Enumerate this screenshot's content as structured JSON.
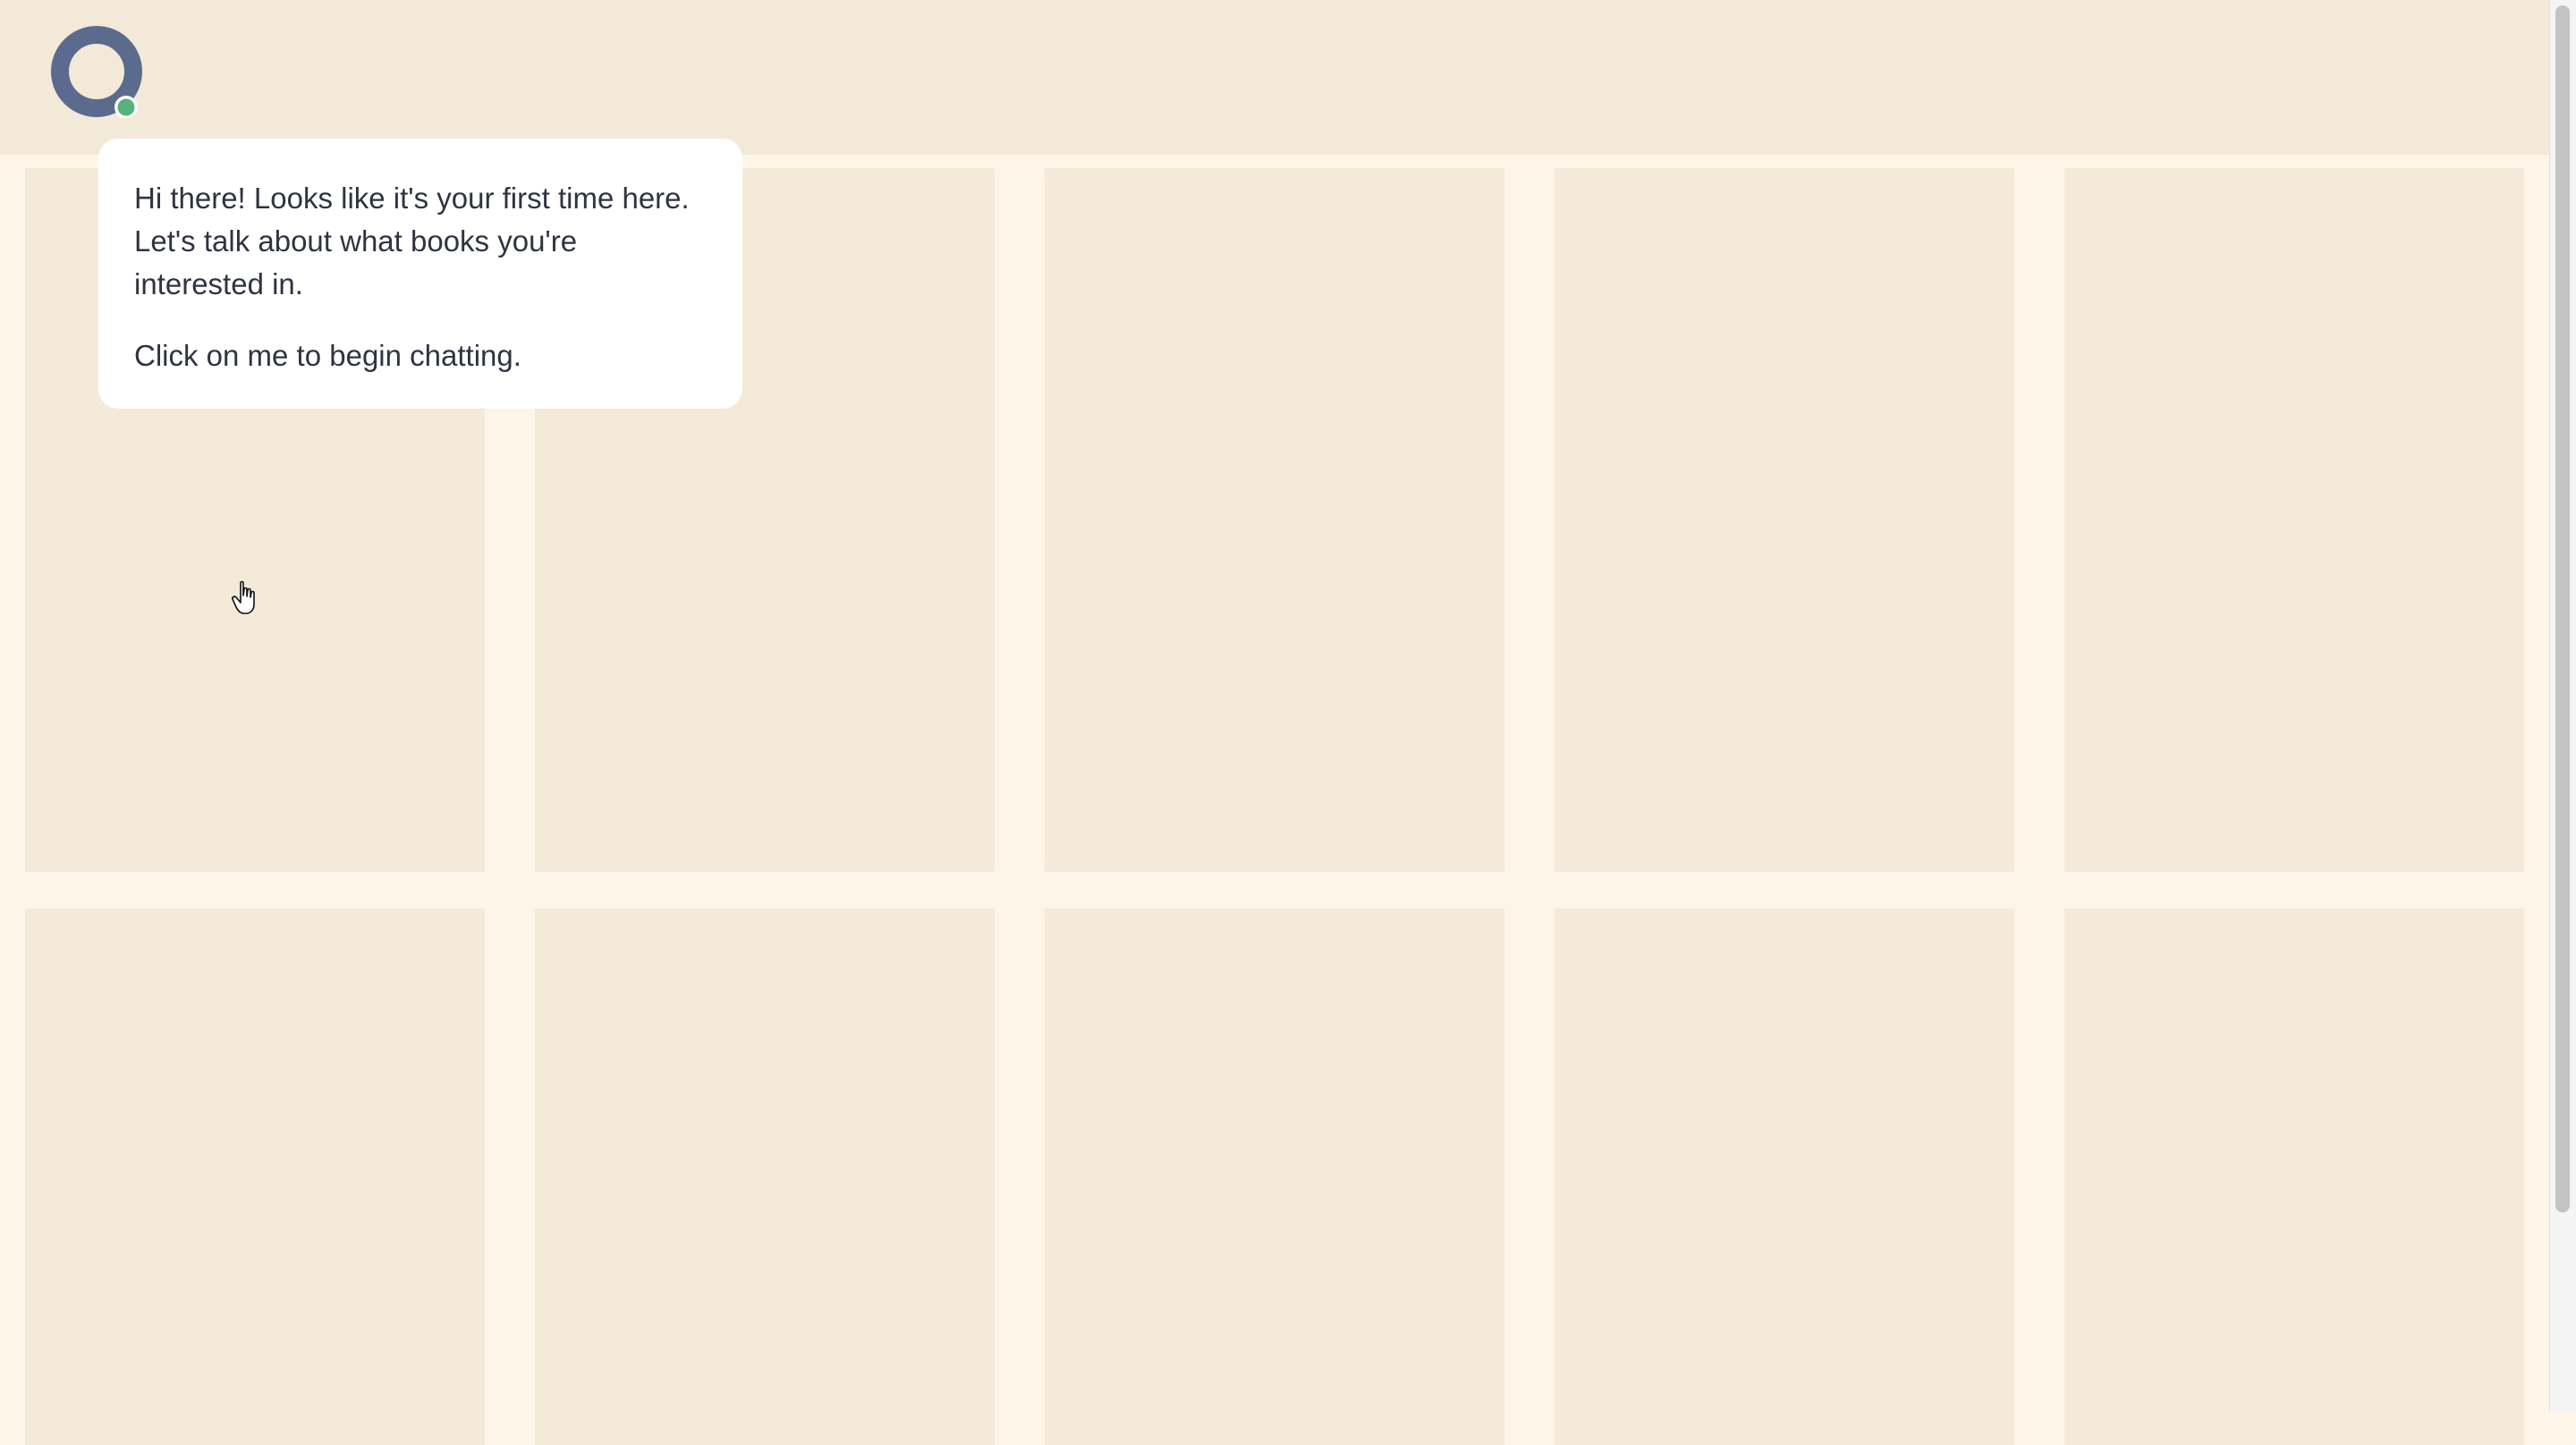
{
  "app": {
    "logo_icon": "chat-ring-logo-icon",
    "status_color": "#55b27a",
    "logo_color": "#5b6b8d"
  },
  "chat_bubble": {
    "line1": "Hi there! Looks like it's your first time here. Let's talk about what books you're interested in.",
    "line2": "Click on me to begin chatting."
  },
  "grid": {
    "rows": 2,
    "columns": 5,
    "tile_color": "#f4ead9"
  },
  "cursor": {
    "icon": "hand-pointer-icon"
  }
}
